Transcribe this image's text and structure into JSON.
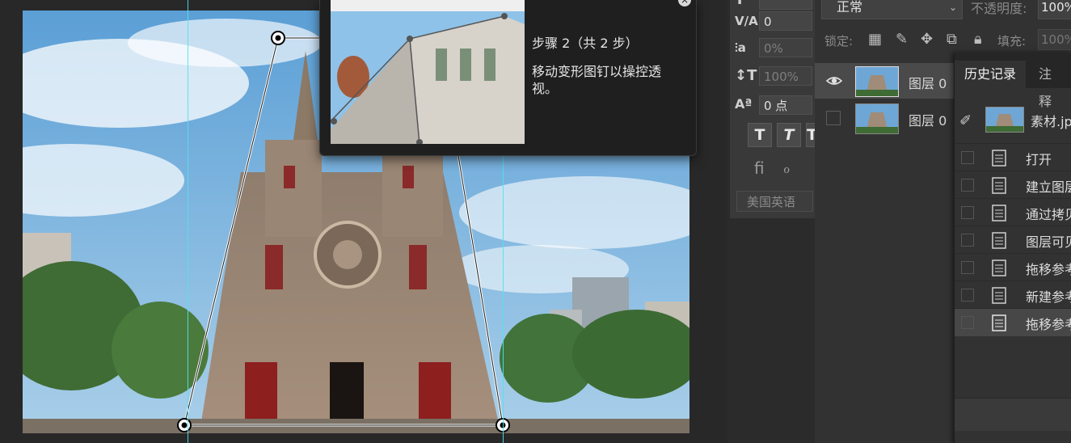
{
  "tooltip": {
    "step_title": "步骤 2（共 2 步）",
    "step_description": "移动变形图钉以操控透视。"
  },
  "character_panel": {
    "tracking_value": "0",
    "kerning_value": "0%",
    "leading_value": "100%",
    "baseline_value": "0 点",
    "language": "美国英语"
  },
  "layers_panel": {
    "blend_mode": "正常",
    "opacity_label": "不透明度:",
    "opacity_value": "100%",
    "lock_label": "锁定:",
    "fill_label": "填充:",
    "fill_value": "100%",
    "layers": [
      {
        "name": "图层 0",
        "visible": true,
        "selected": true
      },
      {
        "name": "图层 0",
        "visible": false,
        "selected": false
      }
    ]
  },
  "history_panel": {
    "tabs": [
      "历史记录",
      "注释"
    ],
    "snapshot_label": "素材.jpg",
    "steps": [
      "打开",
      "建立图层",
      "通过拷贝的图层",
      "图层可见性",
      "拖移参考线",
      "新建参考线",
      "拖移参考线"
    ],
    "active_step_index": 6
  },
  "colors": {
    "guide": "#4fe3ef",
    "panel_bg": "#323232",
    "app_bg": "#2b2b2b"
  }
}
